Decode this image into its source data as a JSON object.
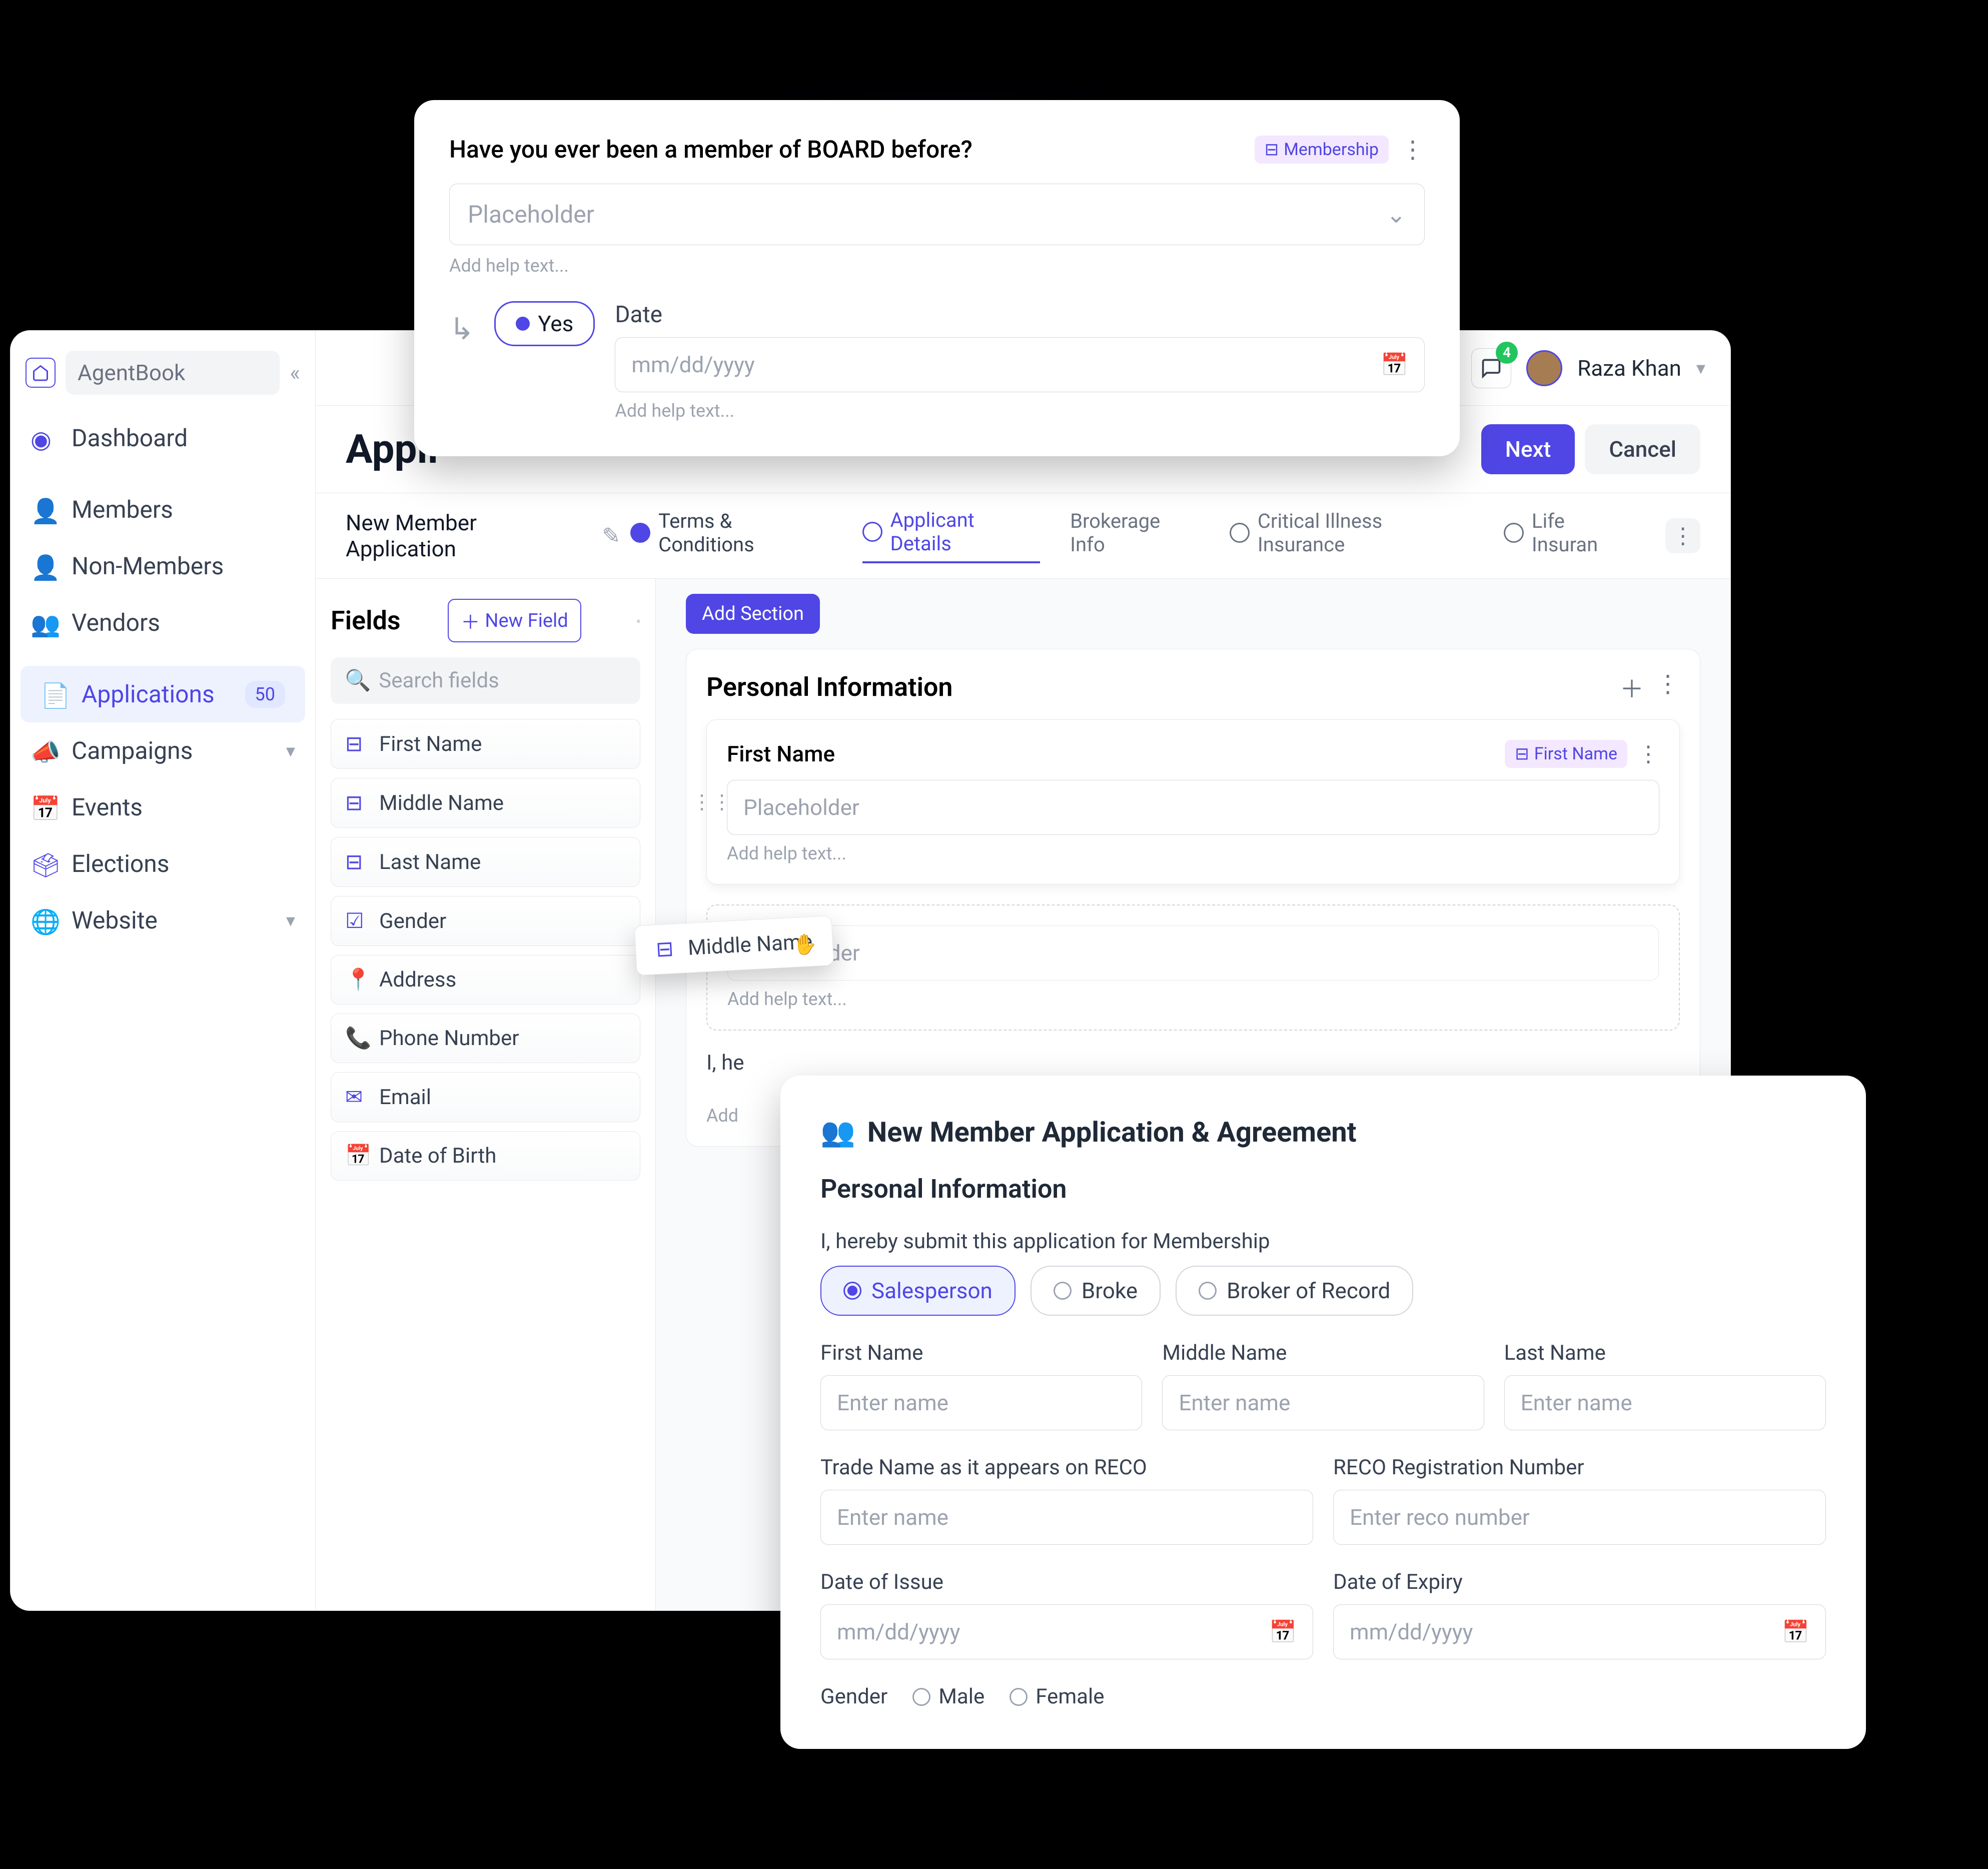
{
  "brand": "AgentBook",
  "user": {
    "name": "Raza Khan",
    "notifications": "4"
  },
  "nav": {
    "dashboard": "Dashboard",
    "members": "Members",
    "nonmembers": "Non-Members",
    "vendors": "Vendors",
    "applications": "Applications",
    "applications_badge": "50",
    "campaigns": "Campaigns",
    "events": "Events",
    "elections": "Elections",
    "website": "Website"
  },
  "page": {
    "title": "Appli",
    "next": "Next",
    "cancel": "Cancel",
    "subtitle": "New Member Application"
  },
  "tabs": {
    "terms": "Terms & Conditions",
    "applicant": "Applicant Details",
    "brokerage": "Brokerage Info",
    "illness": "Critical Illness Insurance",
    "life": "Life Insuran"
  },
  "fields_panel": {
    "title": "Fields",
    "new_field": "New Field",
    "search_ph": "Search fields",
    "items": {
      "first_name": "First Name",
      "middle_name": "Middle Name",
      "last_name": "Last Name",
      "gender": "Gender",
      "address": "Address",
      "phone": "Phone Number",
      "email": "Email",
      "dob": "Date of Birth"
    }
  },
  "canvas": {
    "add_section": "Add Section",
    "section_title": "Personal Information",
    "field1_label": "First Name",
    "field1_tag": "First Name",
    "placeholder": "Placeholder",
    "help": "Add help text...",
    "ghost_label": "I, he",
    "ghost_help": "Add"
  },
  "dragging": "Middle Name",
  "popup": {
    "question": "Have you ever been a member of BOARD before?",
    "tag": "Membership",
    "select_ph": "Placeholder",
    "help": "Add help text...",
    "yes": "Yes",
    "date_label": "Date",
    "date_ph": "mm/dd/yyyy",
    "date_help": "Add help text..."
  },
  "form": {
    "title": "New Member Application & Agreement",
    "section": "Personal Information",
    "intro": "I, hereby submit this application for Membership",
    "roles": {
      "salesperson": "Salesperson",
      "broke": "Broke",
      "broker_record": "Broker of Record"
    },
    "first_name": "First Name",
    "middle_name": "Middle Name",
    "last_name": "Last Name",
    "enter_name": "Enter name",
    "trade_name": "Trade Name as it appears on RECO",
    "reco_num": "RECO Registration Number",
    "reco_ph": "Enter reco number",
    "date_issue": "Date of Issue",
    "date_expiry": "Date of Expiry",
    "date_ph": "mm/dd/yyyy",
    "gender": "Gender",
    "male": "Male",
    "female": "Female"
  }
}
